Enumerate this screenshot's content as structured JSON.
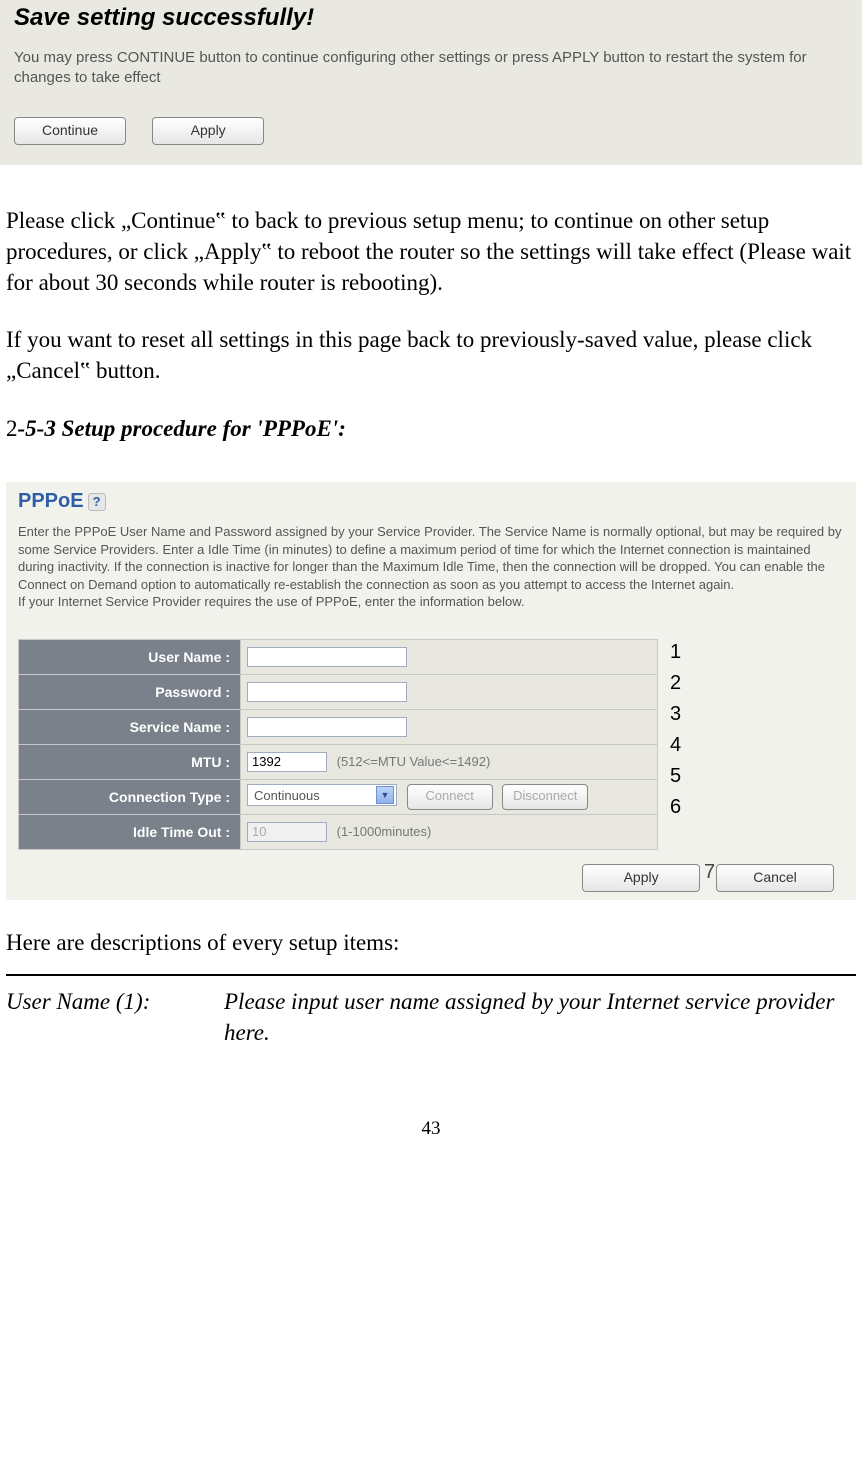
{
  "screenshot1": {
    "title": "Save setting successfully!",
    "subtitle": "You may press CONTINUE button to continue configuring other settings or press APPLY button to restart the system for changes to take effect",
    "continue_btn": "Continue",
    "apply_btn": "Apply"
  },
  "para1": "Please click „Continue‟ to back to previous setup menu; to continue on other setup procedures, or click „Apply‟ to reboot the router so the settings will take effect (Please wait for about 30 seconds while router is rebooting).",
  "para2": "If you want to reset all settings in this page back to previously-saved value, please click „Cancel‟ button.",
  "heading": {
    "num": "2",
    "rest": "-5-3 Setup procedure for 'PPPoE':"
  },
  "pppoe": {
    "title": "PPPoE",
    "desc": "Enter the PPPoE User Name and Password assigned by your Service Provider. The Service Name is normally optional, but may be required by some Service Providers. Enter a Idle Time (in minutes) to define a maximum period of time for which the Internet connection is maintained during inactivity. If the connection is inactive for longer than the Maximum Idle Time, then the connection will be dropped. You can enable the Connect on Demand option to automatically re-establish the connection as soon as you attempt to access the Internet again.\nIf your Internet Service Provider requires the use of PPPoE, enter the information below.",
    "rows": {
      "username_label": "User Name :",
      "password_label": "Password :",
      "service_label": "Service Name :",
      "mtu_label": "MTU :",
      "mtu_value": "1392",
      "mtu_hint": "(512<=MTU Value<=1492)",
      "conn_label": "Connection Type :",
      "conn_value": "Continuous",
      "connect_btn": "Connect",
      "disconnect_btn": "Disconnect",
      "idle_label": "Idle Time Out :",
      "idle_value": "10",
      "idle_hint": "(1-1000minutes)"
    },
    "apply_btn": "Apply",
    "cancel_btn": "Cancel"
  },
  "annotations": [
    "1",
    "2",
    "3",
    "4",
    "5",
    "6"
  ],
  "annotation_seven": "7",
  "desc_intro": "Here are descriptions of every setup items:",
  "desc_row": {
    "left": "User Name (1):",
    "right": "Please input user name assigned by your Internet service provider here."
  },
  "page_number": "43"
}
